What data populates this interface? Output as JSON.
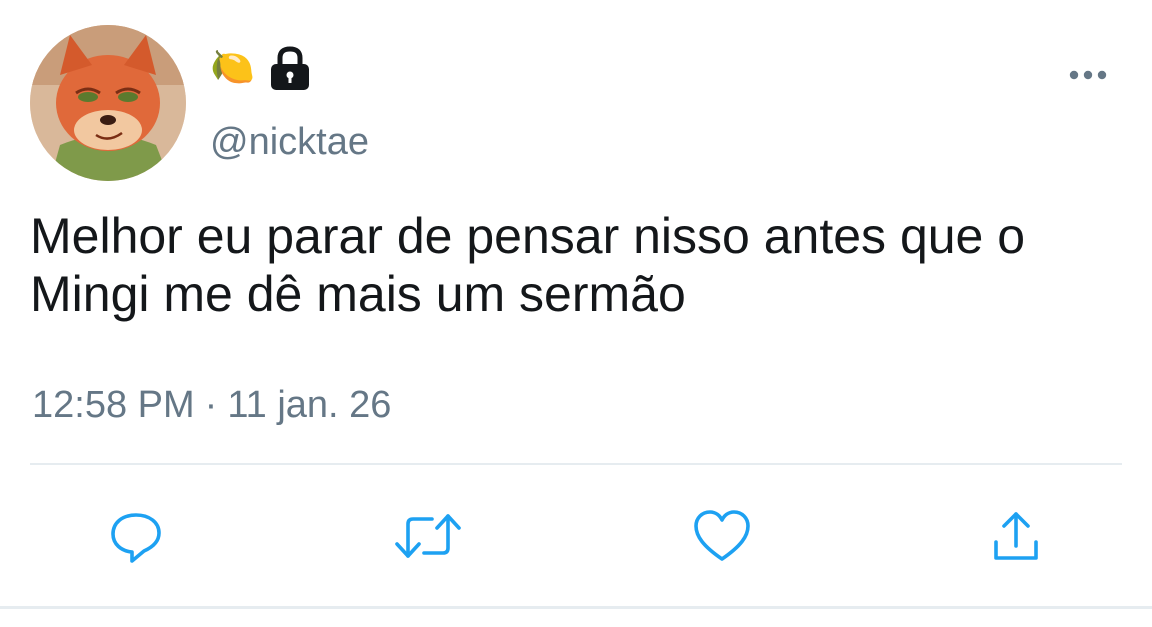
{
  "user": {
    "name_emojis": [
      "🍋"
    ],
    "handle": "@nicktae",
    "lock_icon": "lock-icon",
    "avatar_icon": "avatar-fox"
  },
  "tweet": {
    "text": "Melhor eu parar de pensar nisso antes que o\nMingi me dê mais um sermão",
    "time": "12:58 PM",
    "separator": "·",
    "date": "11 jan. 26"
  },
  "actions": [
    {
      "name": "reply",
      "icon": "reply-icon"
    },
    {
      "name": "retweet",
      "icon": "retweet-icon"
    },
    {
      "name": "like",
      "icon": "heart-icon"
    },
    {
      "name": "share",
      "icon": "share-icon"
    }
  ],
  "colors": {
    "text": "#14171a",
    "secondary": "#657786",
    "icon": "#1da1f2",
    "divider": "#e6ecf0"
  }
}
